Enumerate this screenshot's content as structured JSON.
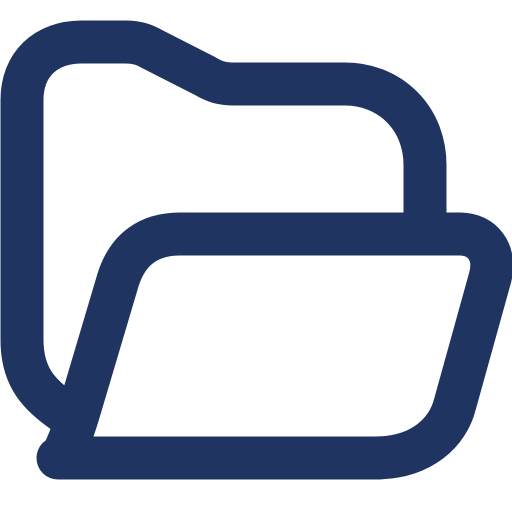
{
  "icon": {
    "name": "folder-open-icon",
    "stroke_color": "#1f3461",
    "background_color": "#ffffff"
  }
}
